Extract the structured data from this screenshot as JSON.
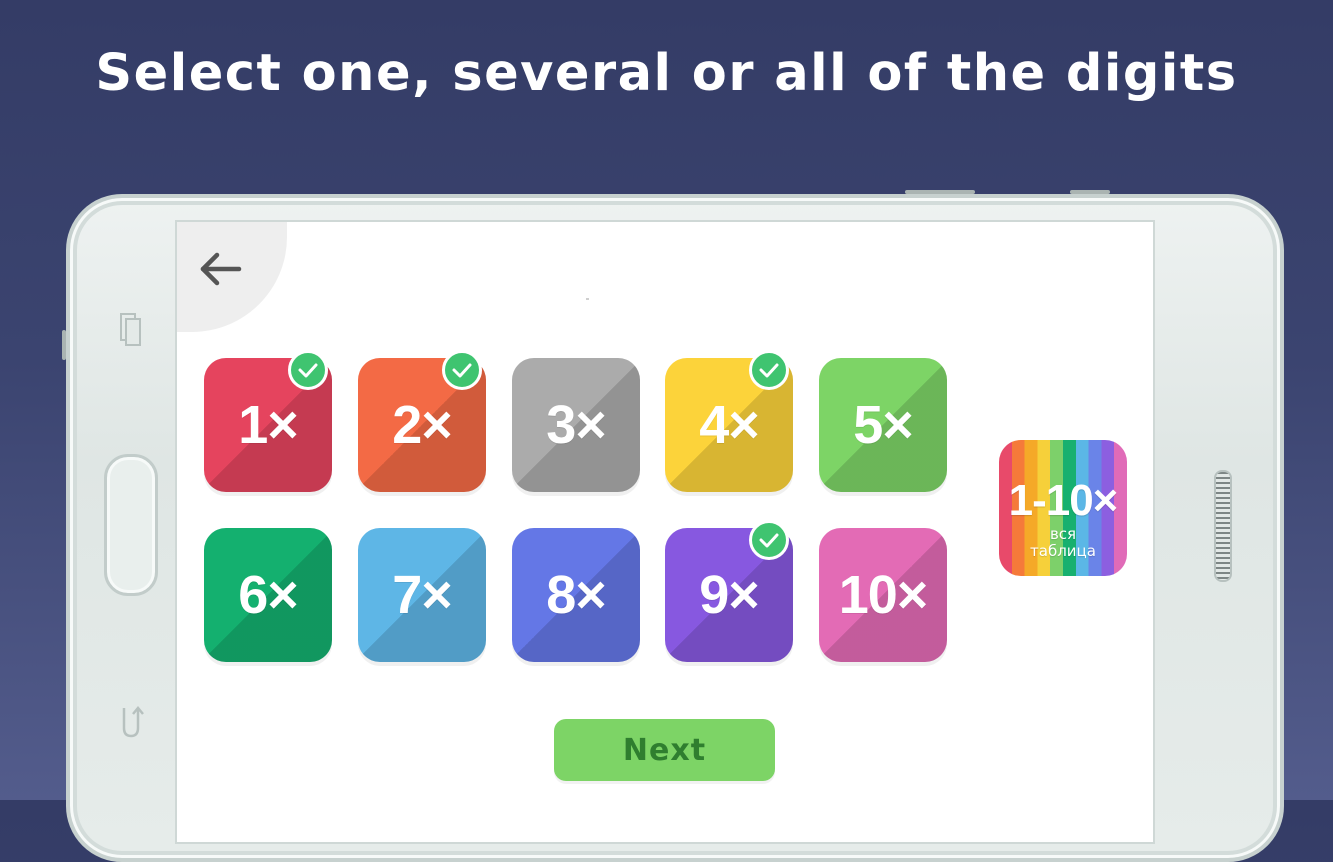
{
  "headline": "Select one, several or all of the digits",
  "colors": {
    "check": "#3fc470",
    "next_bg": "#7dd466",
    "next_text": "#2f7e2f"
  },
  "tiles": [
    {
      "label": "1×",
      "color": "#e5445e",
      "selected": true
    },
    {
      "label": "2×",
      "color": "#f36a45",
      "selected": true
    },
    {
      "label": "3×",
      "color": "#ababab",
      "selected": false
    },
    {
      "label": "4×",
      "color": "#fcd33a",
      "selected": true
    },
    {
      "label": "5×",
      "color": "#7dd466",
      "selected": false
    },
    {
      "label": "6×",
      "color": "#14b06f",
      "selected": false
    },
    {
      "label": "7×",
      "color": "#5eb6e6",
      "selected": false
    },
    {
      "label": "8×",
      "color": "#6477e6",
      "selected": false
    },
    {
      "label": "9×",
      "color": "#8758e0",
      "selected": true
    },
    {
      "label": "10×",
      "color": "#e36bb5",
      "selected": false
    }
  ],
  "all_tile": {
    "label": "1-10×",
    "subtitle_line1": "вся",
    "subtitle_line2": "таблица"
  },
  "next_button": "Next",
  "icons": {
    "back": "arrow-left-icon",
    "check": "checkmark-icon",
    "recent_apps": "recent-apps-icon",
    "back_key": "back-key-icon"
  }
}
